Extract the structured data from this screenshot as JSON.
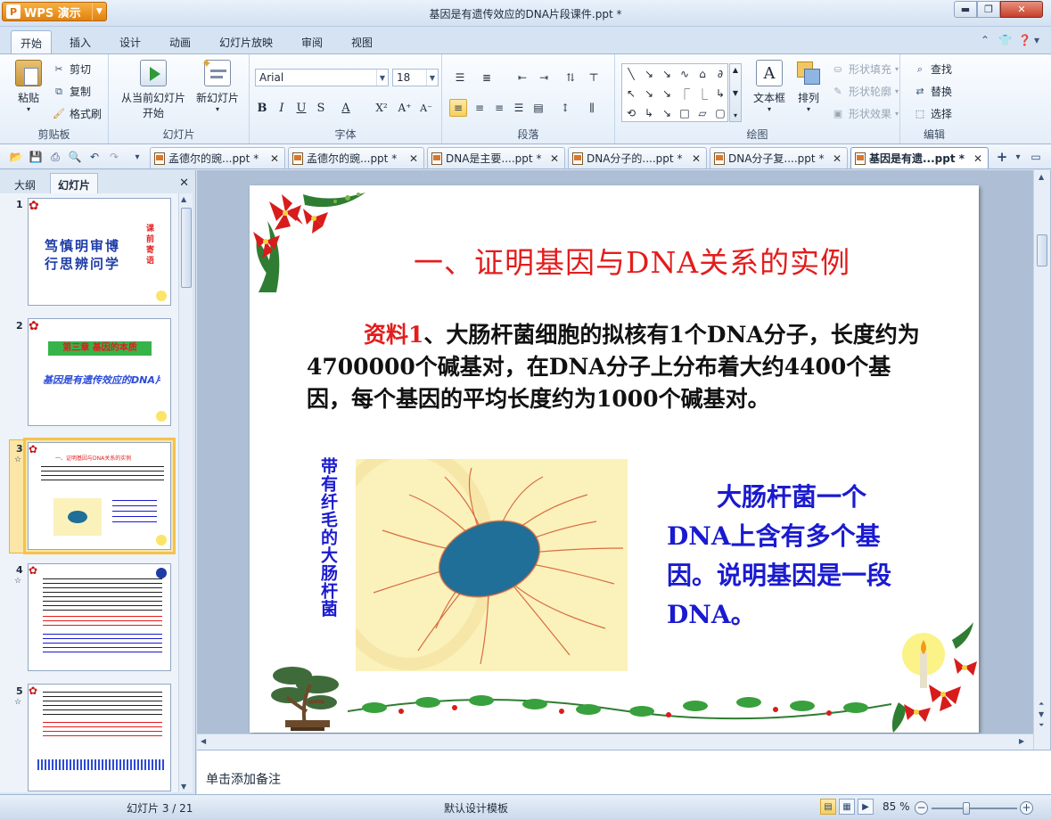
{
  "titlebar": {
    "app_name": "WPS 演示",
    "app_logo_letter": "P",
    "window_title": "基因是有遗传效应的DNA片段课件.ppt *",
    "min_glyph": "▬",
    "max_glyph": "❐",
    "close_glyph": "✕"
  },
  "ribbon_tabs": [
    "开始",
    "插入",
    "设计",
    "动画",
    "幻灯片放映",
    "审阅",
    "视图"
  ],
  "ribbon": {
    "clipboard": {
      "label": "剪贴板",
      "paste": "粘贴",
      "cut": "剪切",
      "copy": "复制",
      "format_painter": "格式刷"
    },
    "slides": {
      "label": "幻灯片",
      "from_current_line1": "从当前幻灯片",
      "from_current_line2": "开始",
      "new_slide": "新幻灯片"
    },
    "font": {
      "label": "字体",
      "font_name": "Arial",
      "font_size": "18",
      "bold": "B",
      "italic": "I",
      "underline": "U",
      "strike": "S",
      "color": "A",
      "superscript": "X²",
      "grow": "A⁺",
      "shrink": "A⁻"
    },
    "paragraph": {
      "label": "段落"
    },
    "drawing": {
      "label": "绘图",
      "shapes": [
        "╲",
        "↘",
        "↘",
        "∿",
        "⌂",
        "∂",
        "↖",
        "↘",
        "↘",
        "⎾",
        "⎿",
        "↳",
        "⟲",
        "↳",
        "↘",
        "□",
        "▱",
        "▢"
      ],
      "textbox": "文本框",
      "arrange": "排列",
      "shape_fill": "形状填充",
      "shape_outline": "形状轮廓",
      "shape_effect": "形状效果"
    },
    "editing": {
      "label": "编辑",
      "find": "查找",
      "replace": "替换",
      "select": "选择"
    }
  },
  "doc_tabs": [
    "孟德尔的豌...ppt *",
    "孟德尔的豌...ppt *",
    "DNA是主要....ppt *",
    "DNA分子的....ppt *",
    "DNA分子复....ppt *",
    "基因是有遗...ppt *"
  ],
  "left_pane": {
    "tab_outline": "大纲",
    "tab_slides": "幻灯片",
    "numbers": [
      "1",
      "2",
      "3",
      "4",
      "5"
    ],
    "slide1": {
      "line1": "笃慎明审博",
      "line2": "行思辨问学",
      "side": "课前寄语"
    },
    "slide2": {
      "header": "第三章  基因的本质",
      "subtitle": "基因是有遗传效应的DNA片段"
    },
    "slide3": {
      "title": "一、证明基因与DNA关系的实例"
    }
  },
  "slide": {
    "title": "一、证明基因与DNA关系的实例",
    "para_label": "资料1",
    "para_text": "、大肠杆菌细胞的拟核有1个DNA分子，长度约为4700000个碱基对，在DNA分子上分布着大约4400个基因，每个基因的平均长度约为1000个碱基对。",
    "side_caption": "带有纤毛的大肠杆菌",
    "conclusion": "大肠杆菌一个DNA上含有多个基因。说明基因是一段DNA。"
  },
  "notes_placeholder": "单击添加备注",
  "status": {
    "slide_counter": "幻灯片 3 / 21",
    "template": "默认设计模板",
    "zoom": "85 %"
  },
  "colors": {
    "title_red": "#e31d1d",
    "text_blue": "#1a1ad0",
    "accent_orange": "#e2810e"
  }
}
